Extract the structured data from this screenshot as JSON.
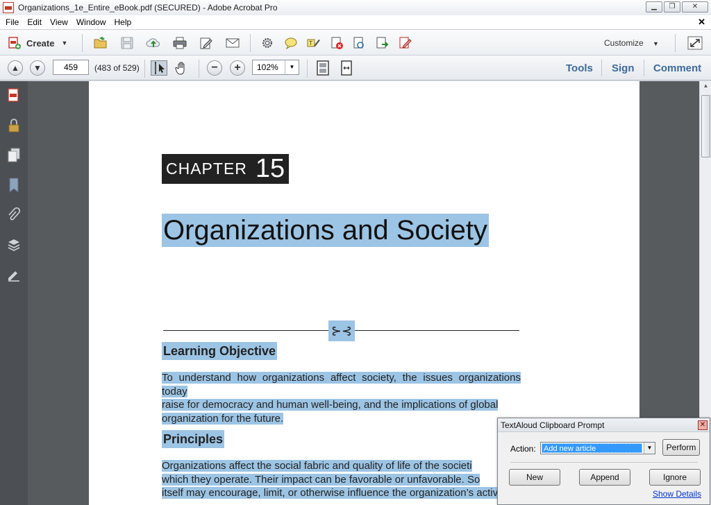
{
  "window": {
    "title": "Organizations_1e_Entire_eBook.pdf (SECURED) - Adobe Acrobat Pro",
    "minimize": "▁",
    "restore": "❐",
    "close": "✕"
  },
  "menu": {
    "items": [
      "File",
      "Edit",
      "View",
      "Window",
      "Help"
    ],
    "close_glyph": "✕"
  },
  "toolbar": {
    "create_label": "Create",
    "customize_label": "Customize",
    "icons": [
      "open-icon",
      "save-icon",
      "upload-icon",
      "print-icon",
      "edit-icon",
      "email-icon",
      "gear-icon",
      "comment-icon",
      "highlight-icon",
      "delete-icon",
      "scan-icon",
      "export-icon",
      "sign-icon"
    ]
  },
  "nav": {
    "page_number": "459",
    "page_of": "(483 of 529)",
    "zoom": "102%",
    "panes": [
      "Tools",
      "Sign",
      "Comment"
    ]
  },
  "leftnav": {
    "icons": [
      "pages-panel-icon",
      "lock-icon",
      "copy-icon",
      "bookmark-icon",
      "attachment-icon",
      "layers-icon",
      "signature-icon"
    ]
  },
  "document": {
    "chapter_word": "CHAPTER",
    "chapter_number": "15",
    "title": "Organizations and Society",
    "ornament": "⊱⊰",
    "section1_heading": "Learning Objective",
    "section1_lines": [
      "To understand how organizations affect society, the issues organizations today",
      "raise for democracy and human well-being, and the implications of global",
      "organization for the future."
    ],
    "section2_heading": "Principles",
    "section2_lines": [
      "Organizations affect the social fabric and quality of life of the societi",
      "which they operate. Their impact can be favorable or unfavorable. So",
      "itself may encourage, limit, or otherwise influence the organization’s activ"
    ]
  },
  "dialog": {
    "title": "TextAloud Clipboard Prompt",
    "close_glyph": "✕",
    "action_label": "Action:",
    "action_value": "Add new article",
    "perform_label": "Perform",
    "new_label": "New",
    "append_label": "Append",
    "ignore_label": "Ignore",
    "details_label": "Show Details"
  }
}
